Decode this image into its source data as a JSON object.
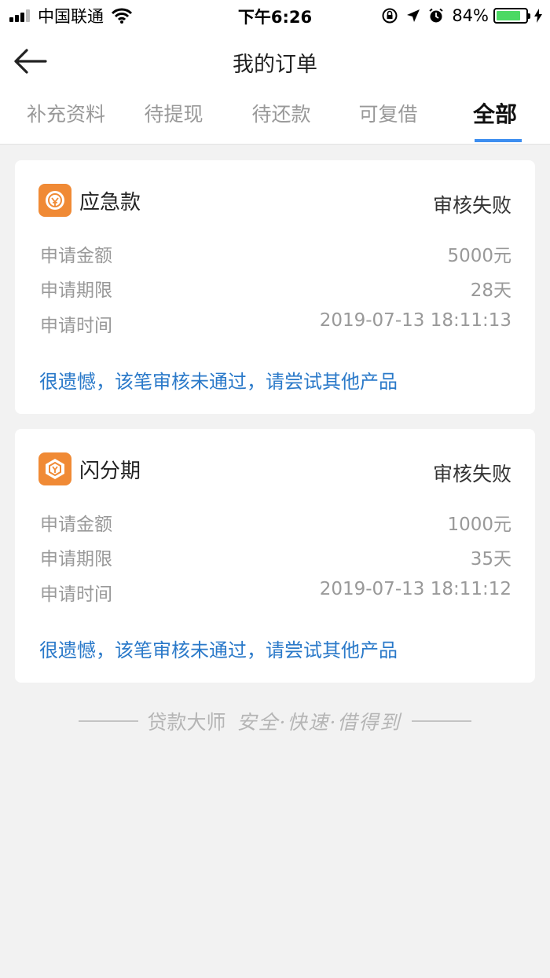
{
  "status_bar": {
    "carrier": "中国联通",
    "time": "下午6:26",
    "battery": "84%",
    "battery_level": 0.84
  },
  "header": {
    "title": "我的订单",
    "back_icon": "back-arrow-icon"
  },
  "tabs": [
    {
      "label": "补充资料",
      "active": false
    },
    {
      "label": "待提现",
      "active": false
    },
    {
      "label": "待还款",
      "active": false
    },
    {
      "label": "可复借",
      "active": false
    },
    {
      "label": "全部",
      "active": true
    }
  ],
  "orders": [
    {
      "product": "应急款",
      "status": "审核失败",
      "rows": [
        {
          "label": "申请金额",
          "value": "5000元"
        },
        {
          "label": "申请期限",
          "value": "28天"
        },
        {
          "label": "申请时间",
          "value": "2019-07-13 18:11:13"
        }
      ],
      "notice": "很遗憾，该笔审核未通过，请尝试其他产品"
    },
    {
      "product": "闪分期",
      "status": "审核失败",
      "rows": [
        {
          "label": "申请金额",
          "value": "1000元"
        },
        {
          "label": "申请期限",
          "value": "35天"
        },
        {
          "label": "申请时间",
          "value": "2019-07-13 18:11:12"
        }
      ],
      "notice": "很遗憾，该笔审核未通过，请尝试其他产品"
    }
  ],
  "footer": {
    "brand": "贷款大师",
    "slogan": "安全·快速·借得到"
  },
  "colors": {
    "accent": "#3d8ef0",
    "notice_text": "#2a79c9",
    "logo_bg": "#f08a35",
    "battery": "#4cd964"
  }
}
